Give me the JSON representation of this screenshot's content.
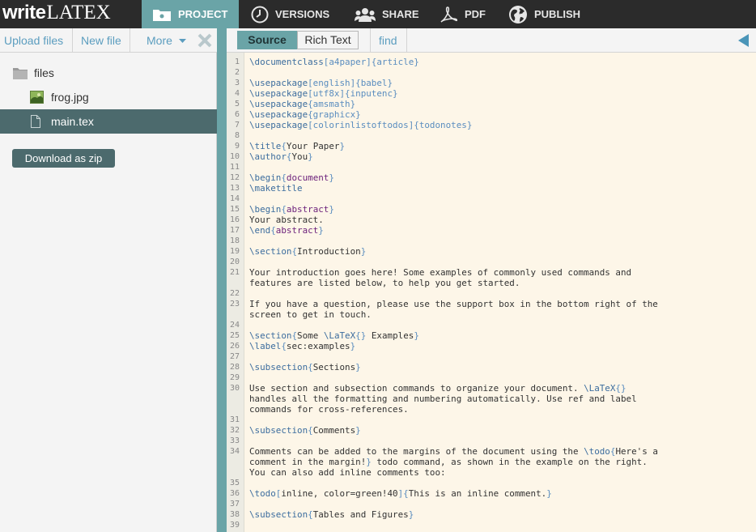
{
  "app": {
    "logo": {
      "write": "write",
      "latex": "LATEX"
    },
    "nav_tabs": [
      {
        "label": "PROJECT",
        "icon": "folder-icon",
        "active": true
      },
      {
        "label": "VERSIONS",
        "icon": "clock-icon"
      },
      {
        "label": "SHARE",
        "icon": "people-icon"
      },
      {
        "label": "PDF",
        "icon": "pdf-icon"
      },
      {
        "label": "PUBLISH",
        "icon": "globe-icon"
      }
    ]
  },
  "sidebar": {
    "toolbar": {
      "upload": "Upload files",
      "newfile": "New file",
      "more": "More",
      "more_icon": "caret-down-icon",
      "close_icon": "close-icon"
    },
    "tree": [
      {
        "label": "files",
        "icon": "folder-icon"
      },
      {
        "label": "frog.jpg",
        "icon": "image-icon"
      },
      {
        "label": "main.tex",
        "icon": "file-icon",
        "selected": true
      }
    ],
    "download_zip": "Download as zip"
  },
  "editor": {
    "tabs": {
      "source": "Source",
      "richtext": "Rich Text"
    },
    "find": "find",
    "collapse_icon": "collapse-left-icon",
    "lines": [
      {
        "n": "1",
        "code": [
          {
            "c": "kw",
            "t": "\\documentclass"
          },
          {
            "c": "br",
            "t": "[a4paper]{article}"
          }
        ]
      },
      {
        "n": "2",
        "code": []
      },
      {
        "n": "3",
        "code": [
          {
            "c": "kw",
            "t": "\\usepackage"
          },
          {
            "c": "br",
            "t": "[english]{babel}"
          }
        ]
      },
      {
        "n": "4",
        "code": [
          {
            "c": "kw",
            "t": "\\usepackage"
          },
          {
            "c": "br",
            "t": "[utf8x]{inputenc}"
          }
        ]
      },
      {
        "n": "5",
        "code": [
          {
            "c": "kw",
            "t": "\\usepackage"
          },
          {
            "c": "br",
            "t": "{amsmath}"
          }
        ]
      },
      {
        "n": "6",
        "code": [
          {
            "c": "kw",
            "t": "\\usepackage"
          },
          {
            "c": "br",
            "t": "{graphicx}"
          }
        ]
      },
      {
        "n": "7",
        "code": [
          {
            "c": "kw",
            "t": "\\usepackage"
          },
          {
            "c": "br",
            "t": "[colorinlistoftodos]{todonotes}"
          }
        ]
      },
      {
        "n": "8",
        "code": []
      },
      {
        "n": "9",
        "code": [
          {
            "c": "kw",
            "t": "\\title"
          },
          {
            "c": "br",
            "t": "{"
          },
          {
            "c": "",
            "t": "Your Paper"
          },
          {
            "c": "br",
            "t": "}"
          }
        ]
      },
      {
        "n": "10",
        "code": [
          {
            "c": "kw",
            "t": "\\author"
          },
          {
            "c": "br",
            "t": "{"
          },
          {
            "c": "",
            "t": "You"
          },
          {
            "c": "br",
            "t": "}"
          }
        ]
      },
      {
        "n": "11",
        "code": []
      },
      {
        "n": "12",
        "code": [
          {
            "c": "kw",
            "t": "\\begin"
          },
          {
            "c": "br",
            "t": "{"
          },
          {
            "c": "env",
            "t": "document"
          },
          {
            "c": "br",
            "t": "}"
          }
        ]
      },
      {
        "n": "13",
        "code": [
          {
            "c": "kw",
            "t": "\\maketitle"
          }
        ]
      },
      {
        "n": "14",
        "code": []
      },
      {
        "n": "15",
        "code": [
          {
            "c": "kw",
            "t": "\\begin"
          },
          {
            "c": "br",
            "t": "{"
          },
          {
            "c": "env",
            "t": "abstract"
          },
          {
            "c": "br",
            "t": "}"
          }
        ]
      },
      {
        "n": "16",
        "code": [
          {
            "c": "",
            "t": "Your abstract."
          }
        ]
      },
      {
        "n": "17",
        "code": [
          {
            "c": "kw",
            "t": "\\end"
          },
          {
            "c": "br",
            "t": "{"
          },
          {
            "c": "env",
            "t": "abstract"
          },
          {
            "c": "br",
            "t": "}"
          }
        ]
      },
      {
        "n": "18",
        "code": []
      },
      {
        "n": "19",
        "code": [
          {
            "c": "kw",
            "t": "\\section"
          },
          {
            "c": "br",
            "t": "{"
          },
          {
            "c": "",
            "t": "Introduction"
          },
          {
            "c": "br",
            "t": "}"
          }
        ]
      },
      {
        "n": "20",
        "code": []
      },
      {
        "n": "21",
        "code": [
          {
            "c": "",
            "t": "Your introduction goes here! Some examples of commonly used commands and"
          }
        ]
      },
      {
        "n": "",
        "code": [
          {
            "c": "",
            "t": "features are listed below, to help you get started."
          }
        ]
      },
      {
        "n": "22",
        "code": []
      },
      {
        "n": "23",
        "code": [
          {
            "c": "",
            "t": "If you have a question, please use the support box in the bottom right of the"
          }
        ]
      },
      {
        "n": "",
        "code": [
          {
            "c": "",
            "t": "screen to get in touch."
          }
        ]
      },
      {
        "n": "24",
        "code": []
      },
      {
        "n": "25",
        "code": [
          {
            "c": "kw",
            "t": "\\section"
          },
          {
            "c": "br",
            "t": "{"
          },
          {
            "c": "",
            "t": "Some "
          },
          {
            "c": "kw",
            "t": "\\LaTeX"
          },
          {
            "c": "br",
            "t": "{}"
          },
          {
            "c": "",
            "t": " Examples"
          },
          {
            "c": "br",
            "t": "}"
          }
        ]
      },
      {
        "n": "26",
        "code": [
          {
            "c": "kw",
            "t": "\\label"
          },
          {
            "c": "br",
            "t": "{"
          },
          {
            "c": "",
            "t": "sec:examples"
          },
          {
            "c": "br",
            "t": "}"
          }
        ]
      },
      {
        "n": "27",
        "code": []
      },
      {
        "n": "28",
        "code": [
          {
            "c": "kw",
            "t": "\\subsection"
          },
          {
            "c": "br",
            "t": "{"
          },
          {
            "c": "",
            "t": "Sections"
          },
          {
            "c": "br",
            "t": "}"
          }
        ]
      },
      {
        "n": "29",
        "code": []
      },
      {
        "n": "30",
        "code": [
          {
            "c": "",
            "t": "Use section and subsection commands to organize your document. "
          },
          {
            "c": "kw",
            "t": "\\LaTeX"
          },
          {
            "c": "br",
            "t": "{}"
          }
        ]
      },
      {
        "n": "",
        "code": [
          {
            "c": "",
            "t": "handles all the formatting and numbering automatically. Use ref and label"
          }
        ]
      },
      {
        "n": "",
        "code": [
          {
            "c": "",
            "t": "commands for cross-references."
          }
        ]
      },
      {
        "n": "31",
        "code": []
      },
      {
        "n": "32",
        "code": [
          {
            "c": "kw",
            "t": "\\subsection"
          },
          {
            "c": "br",
            "t": "{"
          },
          {
            "c": "",
            "t": "Comments"
          },
          {
            "c": "br",
            "t": "}"
          }
        ]
      },
      {
        "n": "33",
        "code": []
      },
      {
        "n": "34",
        "code": [
          {
            "c": "",
            "t": "Comments can be added to the margins of the document using the "
          },
          {
            "c": "kw",
            "t": "\\todo"
          },
          {
            "c": "br",
            "t": "{"
          },
          {
            "c": "",
            "t": "Here's a"
          }
        ]
      },
      {
        "n": "",
        "code": [
          {
            "c": "",
            "t": "comment in the margin!"
          },
          {
            "c": "br",
            "t": "}"
          },
          {
            "c": "",
            "t": " todo command, as shown in the example on the right."
          }
        ]
      },
      {
        "n": "",
        "code": [
          {
            "c": "",
            "t": "You can also add inline comments too:"
          }
        ]
      },
      {
        "n": "35",
        "code": []
      },
      {
        "n": "36",
        "code": [
          {
            "c": "kw",
            "t": "\\todo"
          },
          {
            "c": "br",
            "t": "["
          },
          {
            "c": "",
            "t": "inline, color=green!40"
          },
          {
            "c": "br",
            "t": "]{"
          },
          {
            "c": "",
            "t": "This is an inline comment."
          },
          {
            "c": "br",
            "t": "}"
          }
        ]
      },
      {
        "n": "37",
        "code": []
      },
      {
        "n": "38",
        "code": [
          {
            "c": "kw",
            "t": "\\subsection"
          },
          {
            "c": "br",
            "t": "{"
          },
          {
            "c": "",
            "t": "Tables and Figures"
          },
          {
            "c": "br",
            "t": "}"
          }
        ]
      },
      {
        "n": "39",
        "code": []
      }
    ]
  },
  "colors": {
    "accent": "#6aa4a7",
    "selected": "#4c6a6d",
    "topbar": "#2b2b2b",
    "link": "#5b9dbf",
    "editor_bg": "#fdf6e8"
  }
}
